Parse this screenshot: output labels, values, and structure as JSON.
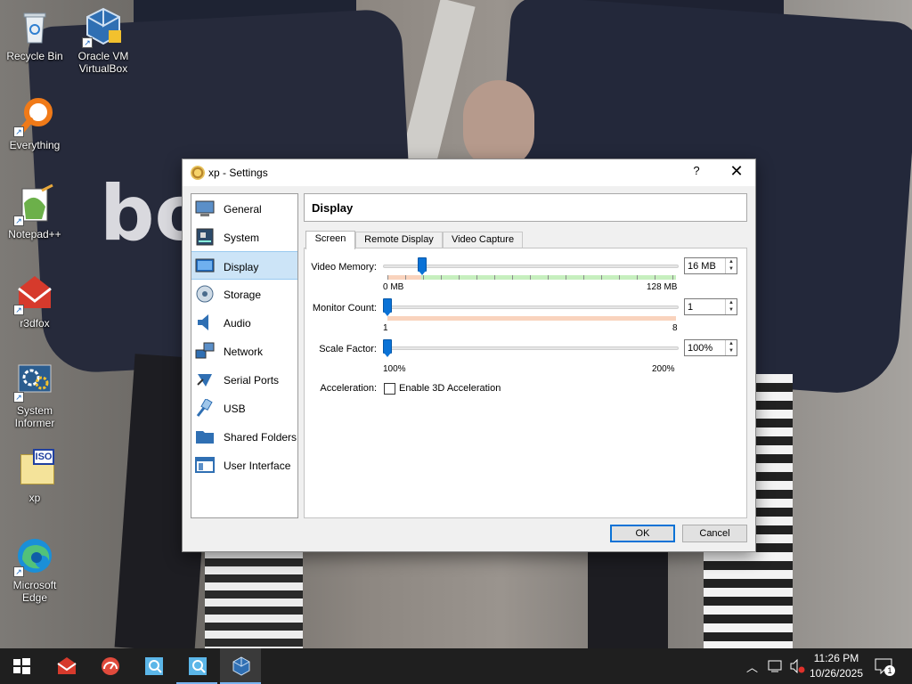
{
  "desktop": {
    "icons": [
      {
        "label": "Recycle Bin",
        "icon": "recycle-bin-icon"
      },
      {
        "label": "Oracle VM VirtualBox",
        "icon": "virtualbox-icon"
      },
      {
        "label": "Everything",
        "icon": "everything-search-icon"
      },
      {
        "label": "Notepad++",
        "icon": "notepadpp-icon"
      },
      {
        "label": "r3dfox",
        "icon": "r3dfox-icon"
      },
      {
        "label": "System Informer",
        "icon": "system-informer-icon"
      },
      {
        "label": "xp",
        "icon": "iso-file-icon"
      },
      {
        "label": "Microsoft Edge",
        "icon": "edge-icon"
      }
    ],
    "iso_text": "ISO",
    "wallpaper_text": "bo"
  },
  "dialog": {
    "title": "xp - Settings",
    "help_glyph": "?",
    "close_glyph": "✕",
    "sidebar": [
      {
        "label": "General"
      },
      {
        "label": "System"
      },
      {
        "label": "Display",
        "selected": true
      },
      {
        "label": "Storage"
      },
      {
        "label": "Audio"
      },
      {
        "label": "Network"
      },
      {
        "label": "Serial Ports"
      },
      {
        "label": "USB"
      },
      {
        "label": "Shared Folders"
      },
      {
        "label": "User Interface"
      }
    ],
    "section_title": "Display",
    "tabs": [
      {
        "label": "Screen",
        "selected": true
      },
      {
        "label": "Remote Display"
      },
      {
        "label": "Video Capture"
      }
    ],
    "video_memory": {
      "label": "Video Memory:",
      "min_label": "0 MB",
      "max_label": "128 MB",
      "value": "16 MB",
      "value_mb": 16,
      "max_mb": 128
    },
    "monitor_count": {
      "label": "Monitor Count:",
      "min_label": "1",
      "max_label": "8",
      "value": "1"
    },
    "scale_factor": {
      "label": "Scale Factor:",
      "min_label": "100%",
      "max_label": "200%",
      "value": "100%"
    },
    "acceleration": {
      "label": "Acceleration:",
      "checkbox_label": "Enable 3D Acceleration",
      "checked": false
    },
    "ok_label": "OK",
    "cancel_label": "Cancel"
  },
  "taskbar": {
    "apps": [
      {
        "icon": "windows-start-icon"
      },
      {
        "icon": "r3dfox-icon"
      },
      {
        "icon": "speed-gauge-icon"
      },
      {
        "icon": "everything-search-icon"
      },
      {
        "icon": "everything-search-icon"
      },
      {
        "icon": "virtualbox-icon",
        "active": true
      }
    ],
    "time": "11:26 PM",
    "date": "10/26/2025",
    "notification_count": "1"
  },
  "colors": {
    "accent": "#0a72d6",
    "selection": "#cce4f7",
    "green_zone": "#c6efbe",
    "orange_zone": "#f9d3bd"
  }
}
